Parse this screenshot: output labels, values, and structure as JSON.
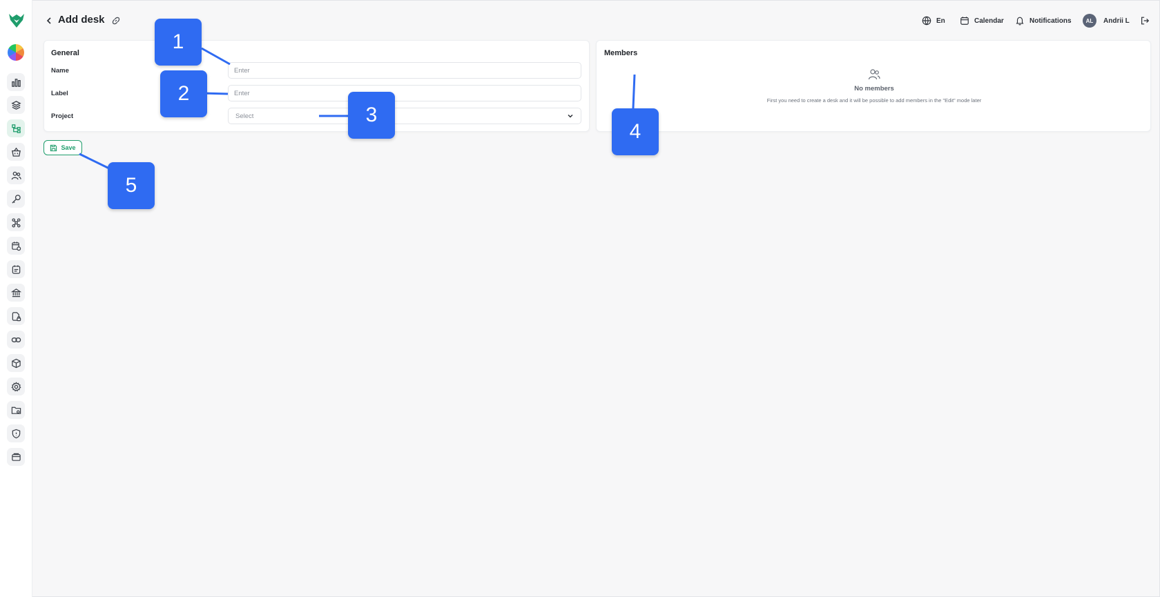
{
  "header": {
    "title": "Add desk",
    "language": "En",
    "calendar_label": "Calendar",
    "notifications_label": "Notifications",
    "user_initials": "AL",
    "user_name": "Andrii L"
  },
  "sidebar": {
    "items": [
      {
        "icon": "analytics-icon"
      },
      {
        "icon": "layers-icon"
      },
      {
        "icon": "hierarchy-icon",
        "active": true
      },
      {
        "icon": "basket-icon"
      },
      {
        "icon": "users-icon"
      },
      {
        "icon": "key-icon"
      },
      {
        "icon": "network-icon"
      },
      {
        "icon": "calendar-settings-icon"
      },
      {
        "icon": "calendar-notes-icon"
      },
      {
        "icon": "bank-icon"
      },
      {
        "icon": "document-lock-icon"
      },
      {
        "icon": "link-icon"
      },
      {
        "icon": "cube-icon"
      },
      {
        "icon": "settings-icon"
      },
      {
        "icon": "folder-icon"
      },
      {
        "icon": "shield-icon"
      },
      {
        "icon": "cards-icon"
      }
    ]
  },
  "general": {
    "title": "General",
    "name_label": "Name",
    "name_placeholder": "Enter",
    "label_label": "Label",
    "label_placeholder": "Enter",
    "project_label": "Project",
    "project_placeholder": "Select"
  },
  "members": {
    "title": "Members",
    "empty_title": "No members",
    "empty_desc": "First you need to create a desk and it will be possible to add members in the \"Edit\" mode later"
  },
  "actions": {
    "save_label": "Save"
  },
  "callouts": [
    "1",
    "2",
    "3",
    "4",
    "5"
  ],
  "colors": {
    "accent": "#1f9d6c",
    "callout": "#2f6bf2",
    "avatar": "#5b6477"
  }
}
